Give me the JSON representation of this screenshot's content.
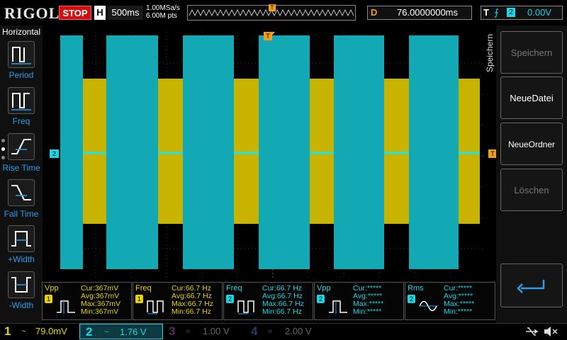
{
  "brand": "RIGOL",
  "run_state": "STOP",
  "horizontal": {
    "mode_letter": "H",
    "timebase": "500ms",
    "sample_rate": "1.00MSa/s",
    "points": "6.00M pts",
    "delay_label": "D",
    "delay_value": "76.0000000ms"
  },
  "trigger": {
    "label": "T",
    "edge_symbol": "⨍",
    "source": "2",
    "level": "0.00V",
    "marker": "T"
  },
  "left_menu": {
    "title": "Horizontal",
    "items": [
      {
        "label": "Period",
        "icon": "period-icon"
      },
      {
        "label": "Freq",
        "icon": "freq-icon"
      },
      {
        "label": "Rise Time",
        "icon": "rise-time-icon"
      },
      {
        "label": "Fall Time",
        "icon": "fall-time-icon"
      },
      {
        "label": "+Width",
        "icon": "positive-width-icon"
      },
      {
        "label": "-Width",
        "icon": "negative-width-icon"
      }
    ]
  },
  "right_menu": {
    "title": "Speichern",
    "buttons": [
      "Speichern",
      "NeueDatei",
      "NeueOrdner",
      "Löschen"
    ]
  },
  "channel_markers": {
    "ch2": "2",
    "trig": "T"
  },
  "measurements": [
    {
      "name": "Vpp",
      "source": "1",
      "color": "#e6d400",
      "cur": "Cur:367mV",
      "avg": "Avg:367mV",
      "max": "Max:367mV",
      "min": "Min:367mV"
    },
    {
      "name": "Freq",
      "source": "1",
      "color": "#e6d400",
      "cur": "Cur:66.7 Hz",
      "avg": "Avg:66.7 Hz",
      "max": "Max:66.7 Hz",
      "min": "Min:66.7 Hz"
    },
    {
      "name": "Freq",
      "source": "2",
      "color": "#19d6e6",
      "cur": "Cur:66.7 Hz",
      "avg": "Avg:66.7 Hz",
      "max": "Max:66.7 Hz",
      "min": "Min:66.7 Hz"
    },
    {
      "name": "Vpp",
      "source": "2",
      "color": "#19d6e6",
      "cur": "Cur:*****",
      "avg": "Avg:*****",
      "max": "Max:*****",
      "min": "Min:*****"
    },
    {
      "name": "Rms",
      "source": "2",
      "color": "#19d6e6",
      "cur": "Cur:*****",
      "avg": "Avg:*****",
      "max": "Max:*****",
      "min": "Min:*****"
    }
  ],
  "channels": [
    {
      "num": "1",
      "coupling": "~",
      "scale": "79.0mV",
      "color": "#e6d400",
      "active": true
    },
    {
      "num": "2",
      "coupling": "~",
      "scale": "1.76 V",
      "color": "#19d6e6",
      "active": true
    },
    {
      "num": "3",
      "coupling": "≈",
      "scale": "1.00 V",
      "color": "#d62fd0",
      "active": false
    },
    {
      "num": "4",
      "coupling": "≈",
      "scale": "2.00 V",
      "color": "#2f6fe0",
      "active": false
    }
  ],
  "status_icons": [
    "usb-icon",
    "mute-icon"
  ],
  "colors": {
    "ch1": "#e6d400",
    "ch2": "#19d6e6",
    "trigger": "#f39c1a",
    "accent": "#2a9fe8",
    "stop": "#d01010"
  }
}
